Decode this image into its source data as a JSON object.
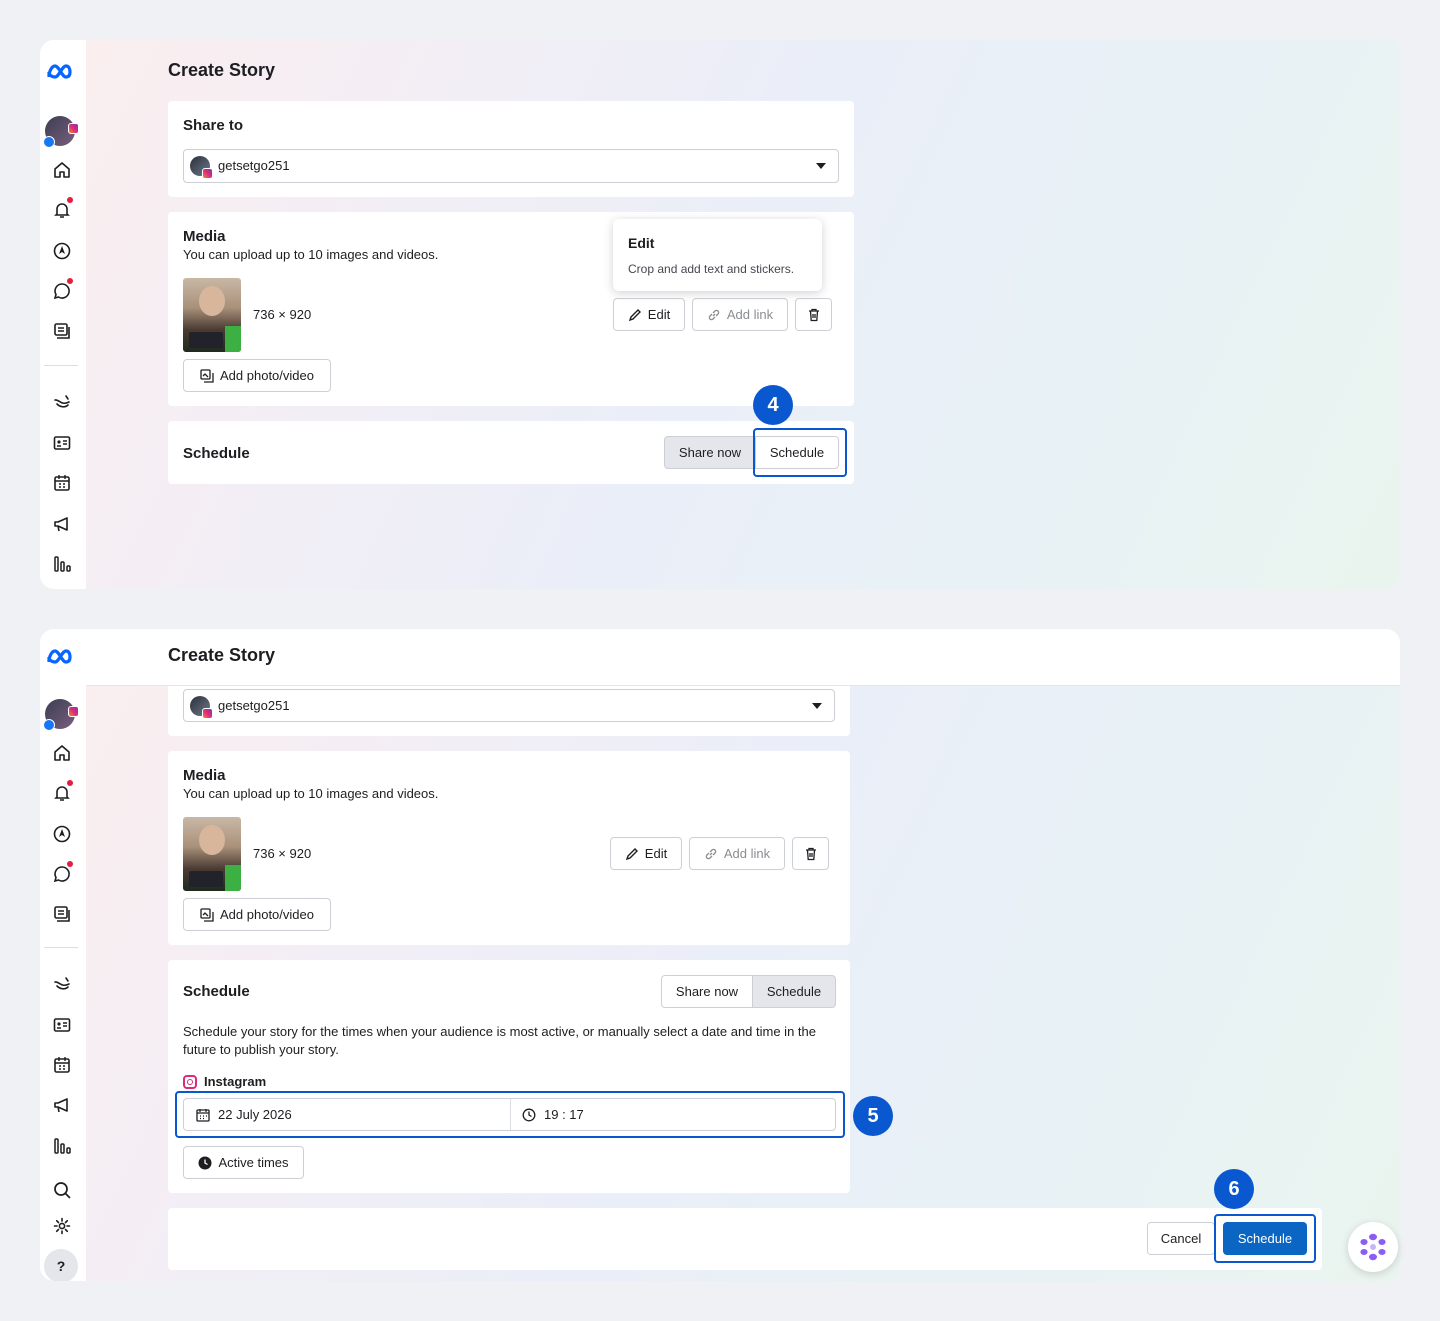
{
  "panel1": {
    "title": "Create Story",
    "share_to": {
      "title": "Share to",
      "account": "getsetgo251"
    },
    "media": {
      "title": "Media",
      "subtitle": "You can upload up to 10 images and videos.",
      "dimensions": "736 × 920",
      "add_label": "Add photo/video",
      "edit_label": "Edit",
      "add_link_label": "Add link"
    },
    "tooltip": {
      "title": "Edit",
      "text": "Crop and add text and stickers."
    },
    "schedule": {
      "title": "Schedule",
      "share_now": "Share now",
      "schedule_btn": "Schedule"
    },
    "step": "4"
  },
  "panel2": {
    "title": "Create Story",
    "account": "getsetgo251",
    "media": {
      "title": "Media",
      "subtitle": "You can upload up to 10 images and videos.",
      "dimensions": "736 × 920",
      "add_label": "Add photo/video",
      "edit_label": "Edit",
      "add_link_label": "Add link"
    },
    "schedule": {
      "title": "Schedule",
      "share_now": "Share now",
      "schedule_btn": "Schedule",
      "description": "Schedule your story for the times when your audience is most active, or manually select a date and time in the future to publish your story.",
      "platform": "Instagram",
      "date": "22 July 2026",
      "time": "19 : 17",
      "active_times": "Active times"
    },
    "footer": {
      "cancel": "Cancel",
      "schedule": "Schedule"
    },
    "step5": "5",
    "step6": "6",
    "help_label": "?"
  },
  "colors": {
    "accent": "#0a58d0",
    "primary_button": "#0a66c2",
    "notification_dot": "#e41e3f"
  },
  "icons": [
    "meta-logo-icon",
    "home-icon",
    "bell-icon",
    "compass-icon",
    "chat-icon",
    "posts-icon",
    "ads-icon",
    "contact-icon",
    "calendar-icon",
    "megaphone-icon",
    "insights-icon",
    "search-icon",
    "gear-icon"
  ]
}
